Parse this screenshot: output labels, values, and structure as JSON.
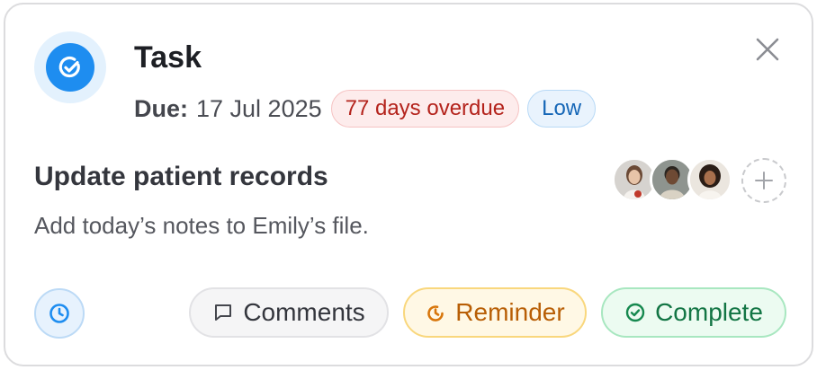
{
  "header": {
    "title": "Task",
    "due_label": "Due:",
    "due_date": "17 Jul 2025",
    "overdue_badge": "77 days overdue",
    "priority_badge": "Low",
    "close_icon": "close-icon",
    "task_icon": "check-circle-icon"
  },
  "body": {
    "subject": "Update patient records",
    "description": "Add today’s notes to Emily’s file.",
    "assignees": [
      {
        "avatar": "avatar-woman-light-background"
      },
      {
        "avatar": "avatar-man-dark-background"
      },
      {
        "avatar": "avatar-woman-curly-hair"
      }
    ],
    "add_assignee_icon": "plus-icon"
  },
  "footer": {
    "clock_icon": "clock-icon",
    "comments_label": "Comments",
    "reminder_label": "Reminder",
    "complete_label": "Complete"
  },
  "colors": {
    "accent": "#1e8df0",
    "overdue": "#b4231c",
    "priority_low": "#1667b7",
    "reminder": "#b85e05",
    "complete": "#127544"
  }
}
